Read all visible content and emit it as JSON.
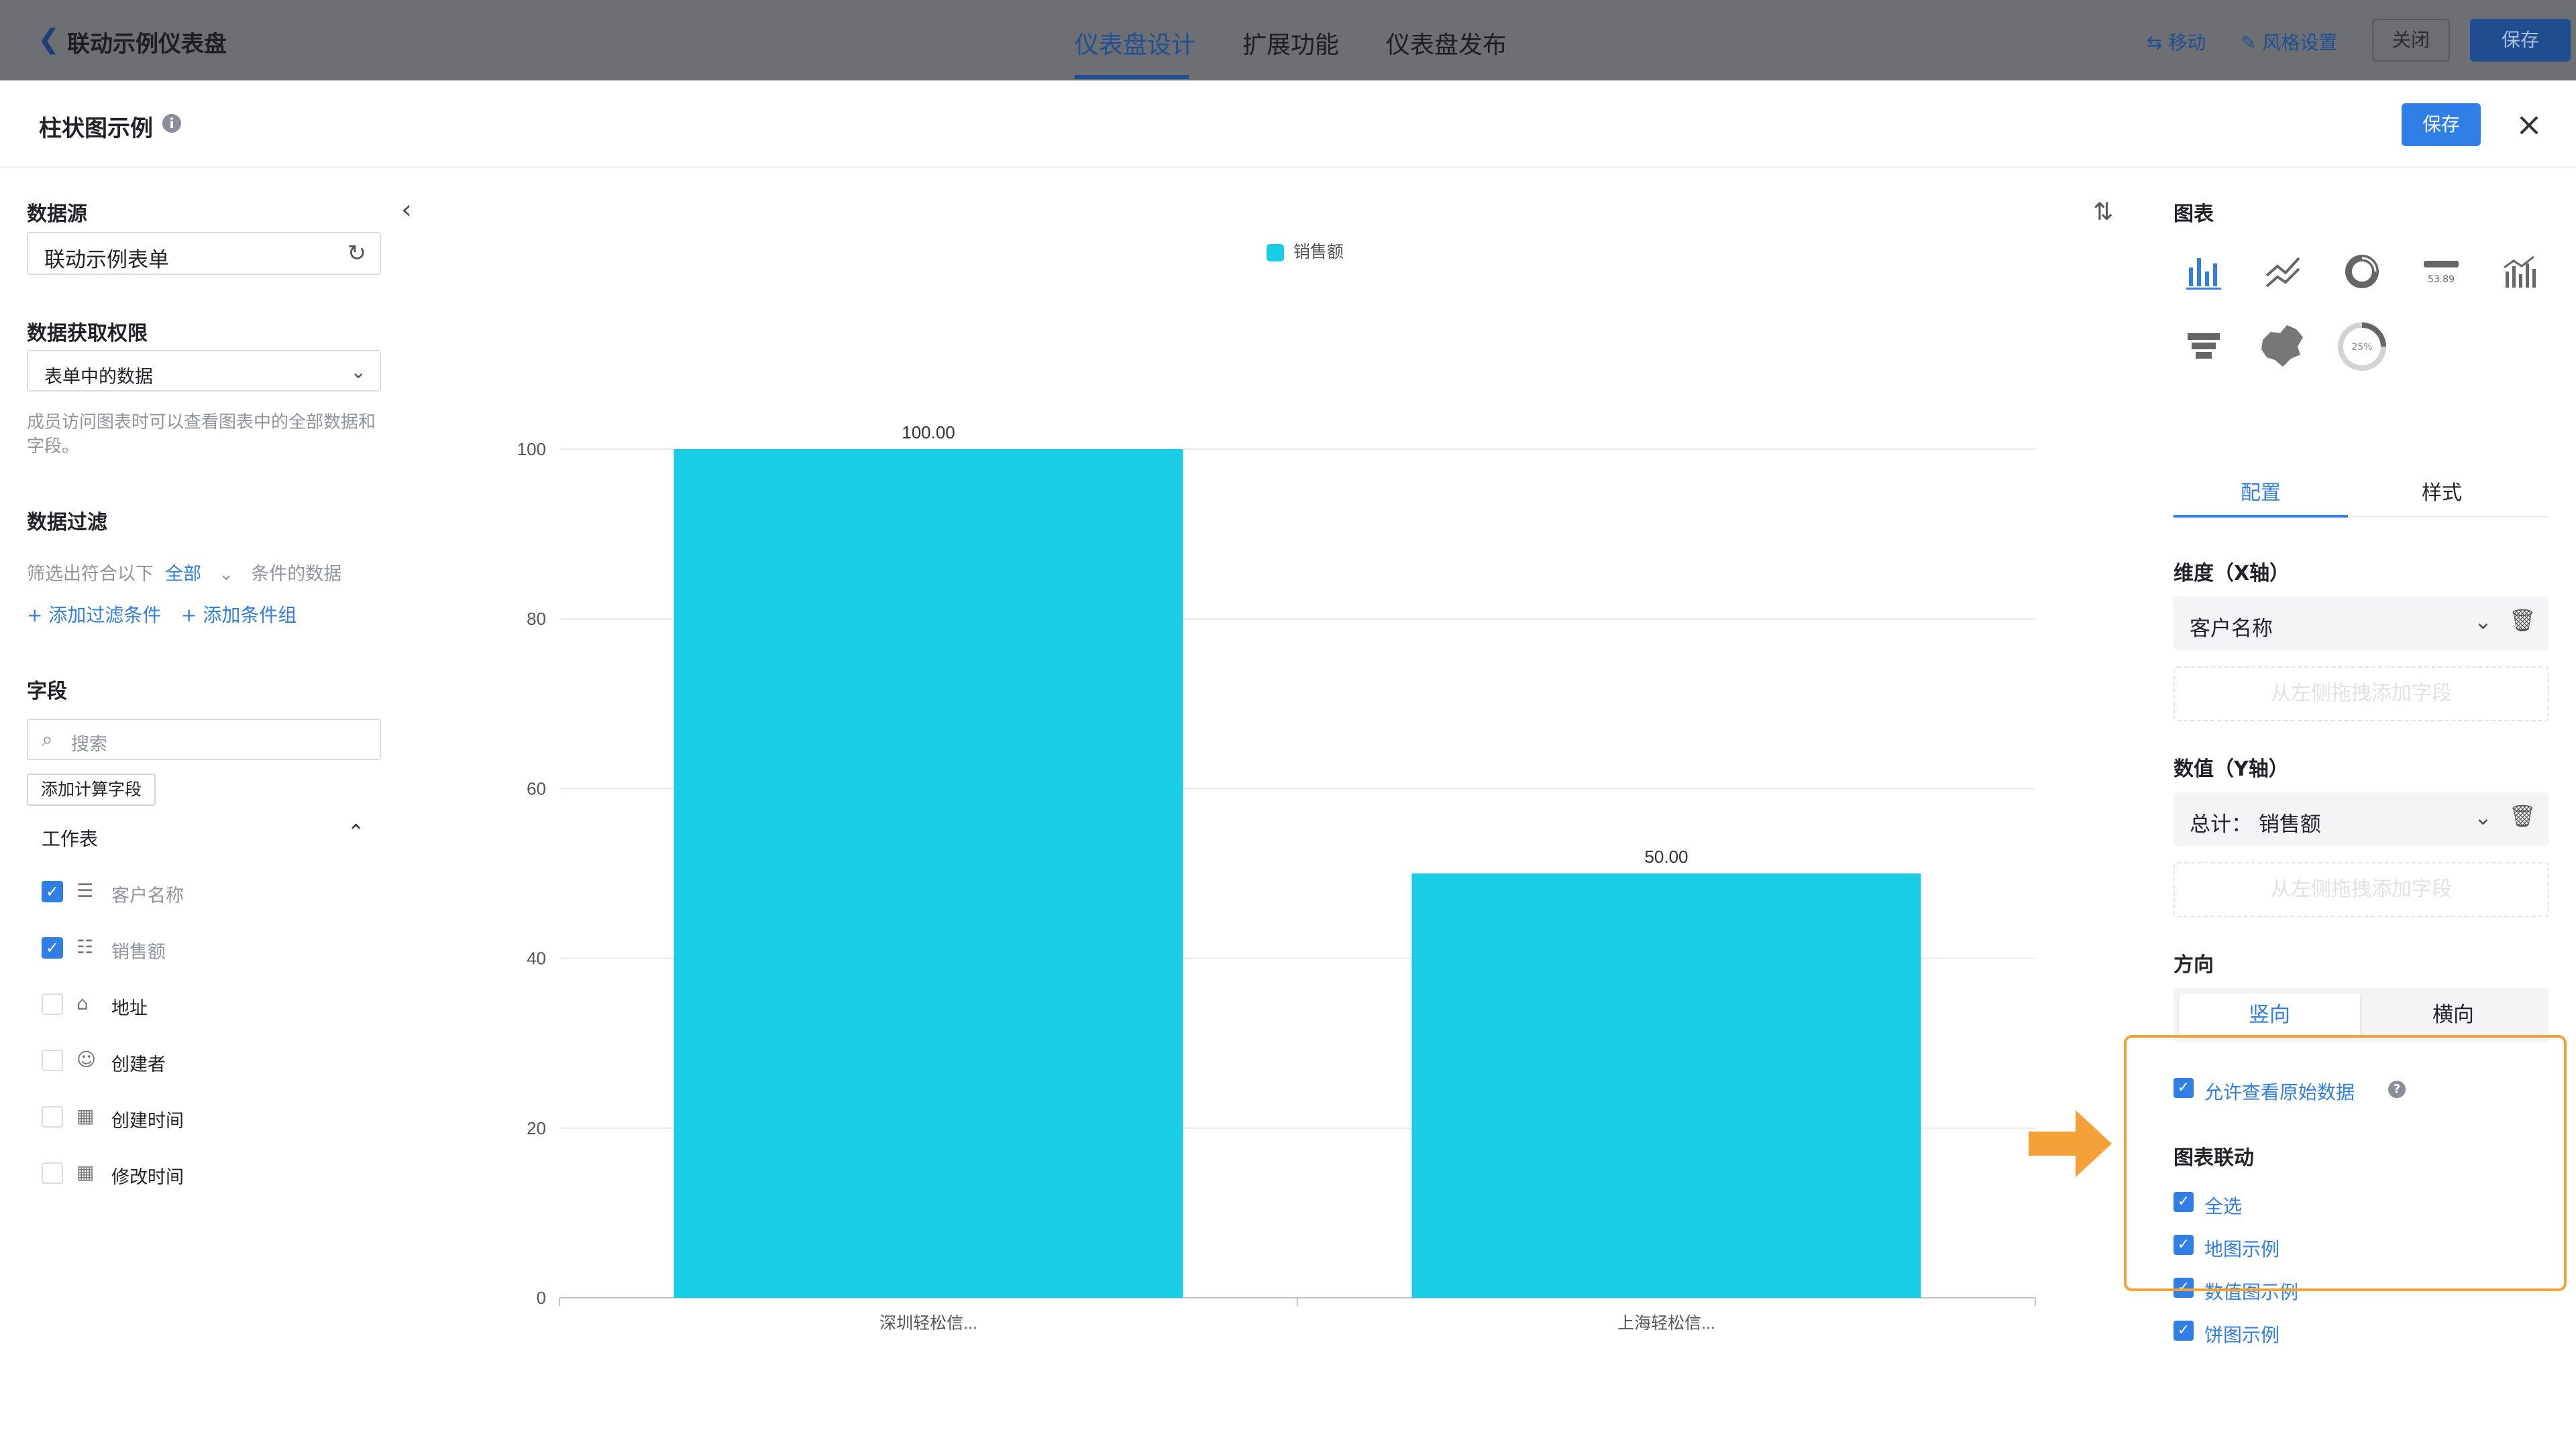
{
  "topbar": {
    "back_icon": "chevron-left-icon",
    "title": "联动示例仪表盘",
    "tabs": [
      "仪表盘设计",
      "扩展功能",
      "仪表盘发布"
    ],
    "active_tab": "仪表盘设计",
    "tools": {
      "move": "移动",
      "style": "风格设置"
    },
    "close_label": "关闭",
    "save_label": "保存"
  },
  "panel": {
    "title": "柱状图示例",
    "save_label": "保存",
    "close_icon": "close-icon"
  },
  "left": {
    "datasource": {
      "heading": "数据源",
      "value": "联动示例表单",
      "refresh_icon": "refresh-icon"
    },
    "permission": {
      "heading": "数据获取权限",
      "value": "表单中的数据",
      "hint": "成员访问图表时可以查看图表中的全部数据和字段。"
    },
    "filter": {
      "heading": "数据过滤",
      "prefix": "筛选出符合以下",
      "mode": "全部",
      "suffix": "条件的数据",
      "add_condition": "添加过滤条件",
      "add_group": "添加条件组"
    },
    "fields": {
      "heading": "字段",
      "search_placeholder": "搜索",
      "add_calc": "添加计算字段",
      "group": "工作表",
      "items": [
        {
          "label": "客户名称",
          "checked": true,
          "icon": "text-lines-icon"
        },
        {
          "label": "销售额",
          "checked": true,
          "icon": "number-icon"
        },
        {
          "label": "地址",
          "checked": false,
          "icon": "building-icon"
        },
        {
          "label": "创建者",
          "checked": false,
          "icon": "user-icon"
        },
        {
          "label": "创建时间",
          "checked": false,
          "icon": "calendar-icon"
        },
        {
          "label": "修改时间",
          "checked": false,
          "icon": "calendar-icon"
        }
      ]
    }
  },
  "chart_data": {
    "type": "bar",
    "categories": [
      "深圳轻松信...",
      "上海轻松信..."
    ],
    "series": [
      {
        "name": "销售额",
        "values": [
          100,
          50
        ],
        "labels": [
          "100.00",
          "50.00"
        ],
        "color": "#19cde6"
      }
    ],
    "ylim": [
      0,
      100
    ],
    "yticks": [
      0,
      20,
      40,
      60,
      80,
      100
    ],
    "legend": "top-center",
    "grid": true
  },
  "right": {
    "chart_heading": "图表",
    "chart_types": [
      "bar-chart-icon",
      "line-chart-icon",
      "donut-chart-icon",
      "number-card-icon",
      "combo-chart-icon",
      "funnel-chart-icon",
      "map-chart-icon",
      "gauge-chart-icon"
    ],
    "number_card_sample": "53.89",
    "gauge_sample": "25%",
    "tabs": [
      "配置",
      "样式"
    ],
    "active_tab": "配置",
    "x_axis": {
      "heading": "维度（X轴）",
      "value": "客户名称",
      "drop_hint": "从左侧拖拽添加字段"
    },
    "y_axis": {
      "heading": "数值（Y轴）",
      "value": "总计：  销售额",
      "drop_hint": "从左侧拖拽添加字段"
    },
    "direction": {
      "heading": "方向",
      "options": [
        "竖向",
        "横向"
      ],
      "selected": "竖向"
    },
    "allow_raw": "允许查看原始数据",
    "linkage": {
      "heading": "图表联动",
      "items": [
        "全选",
        "地图示例",
        "数值图示例",
        "饼图示例"
      ]
    }
  },
  "colors": {
    "accent": "#2f7fe6",
    "bar": "#19cde6",
    "highlight": "#f5a13a"
  }
}
